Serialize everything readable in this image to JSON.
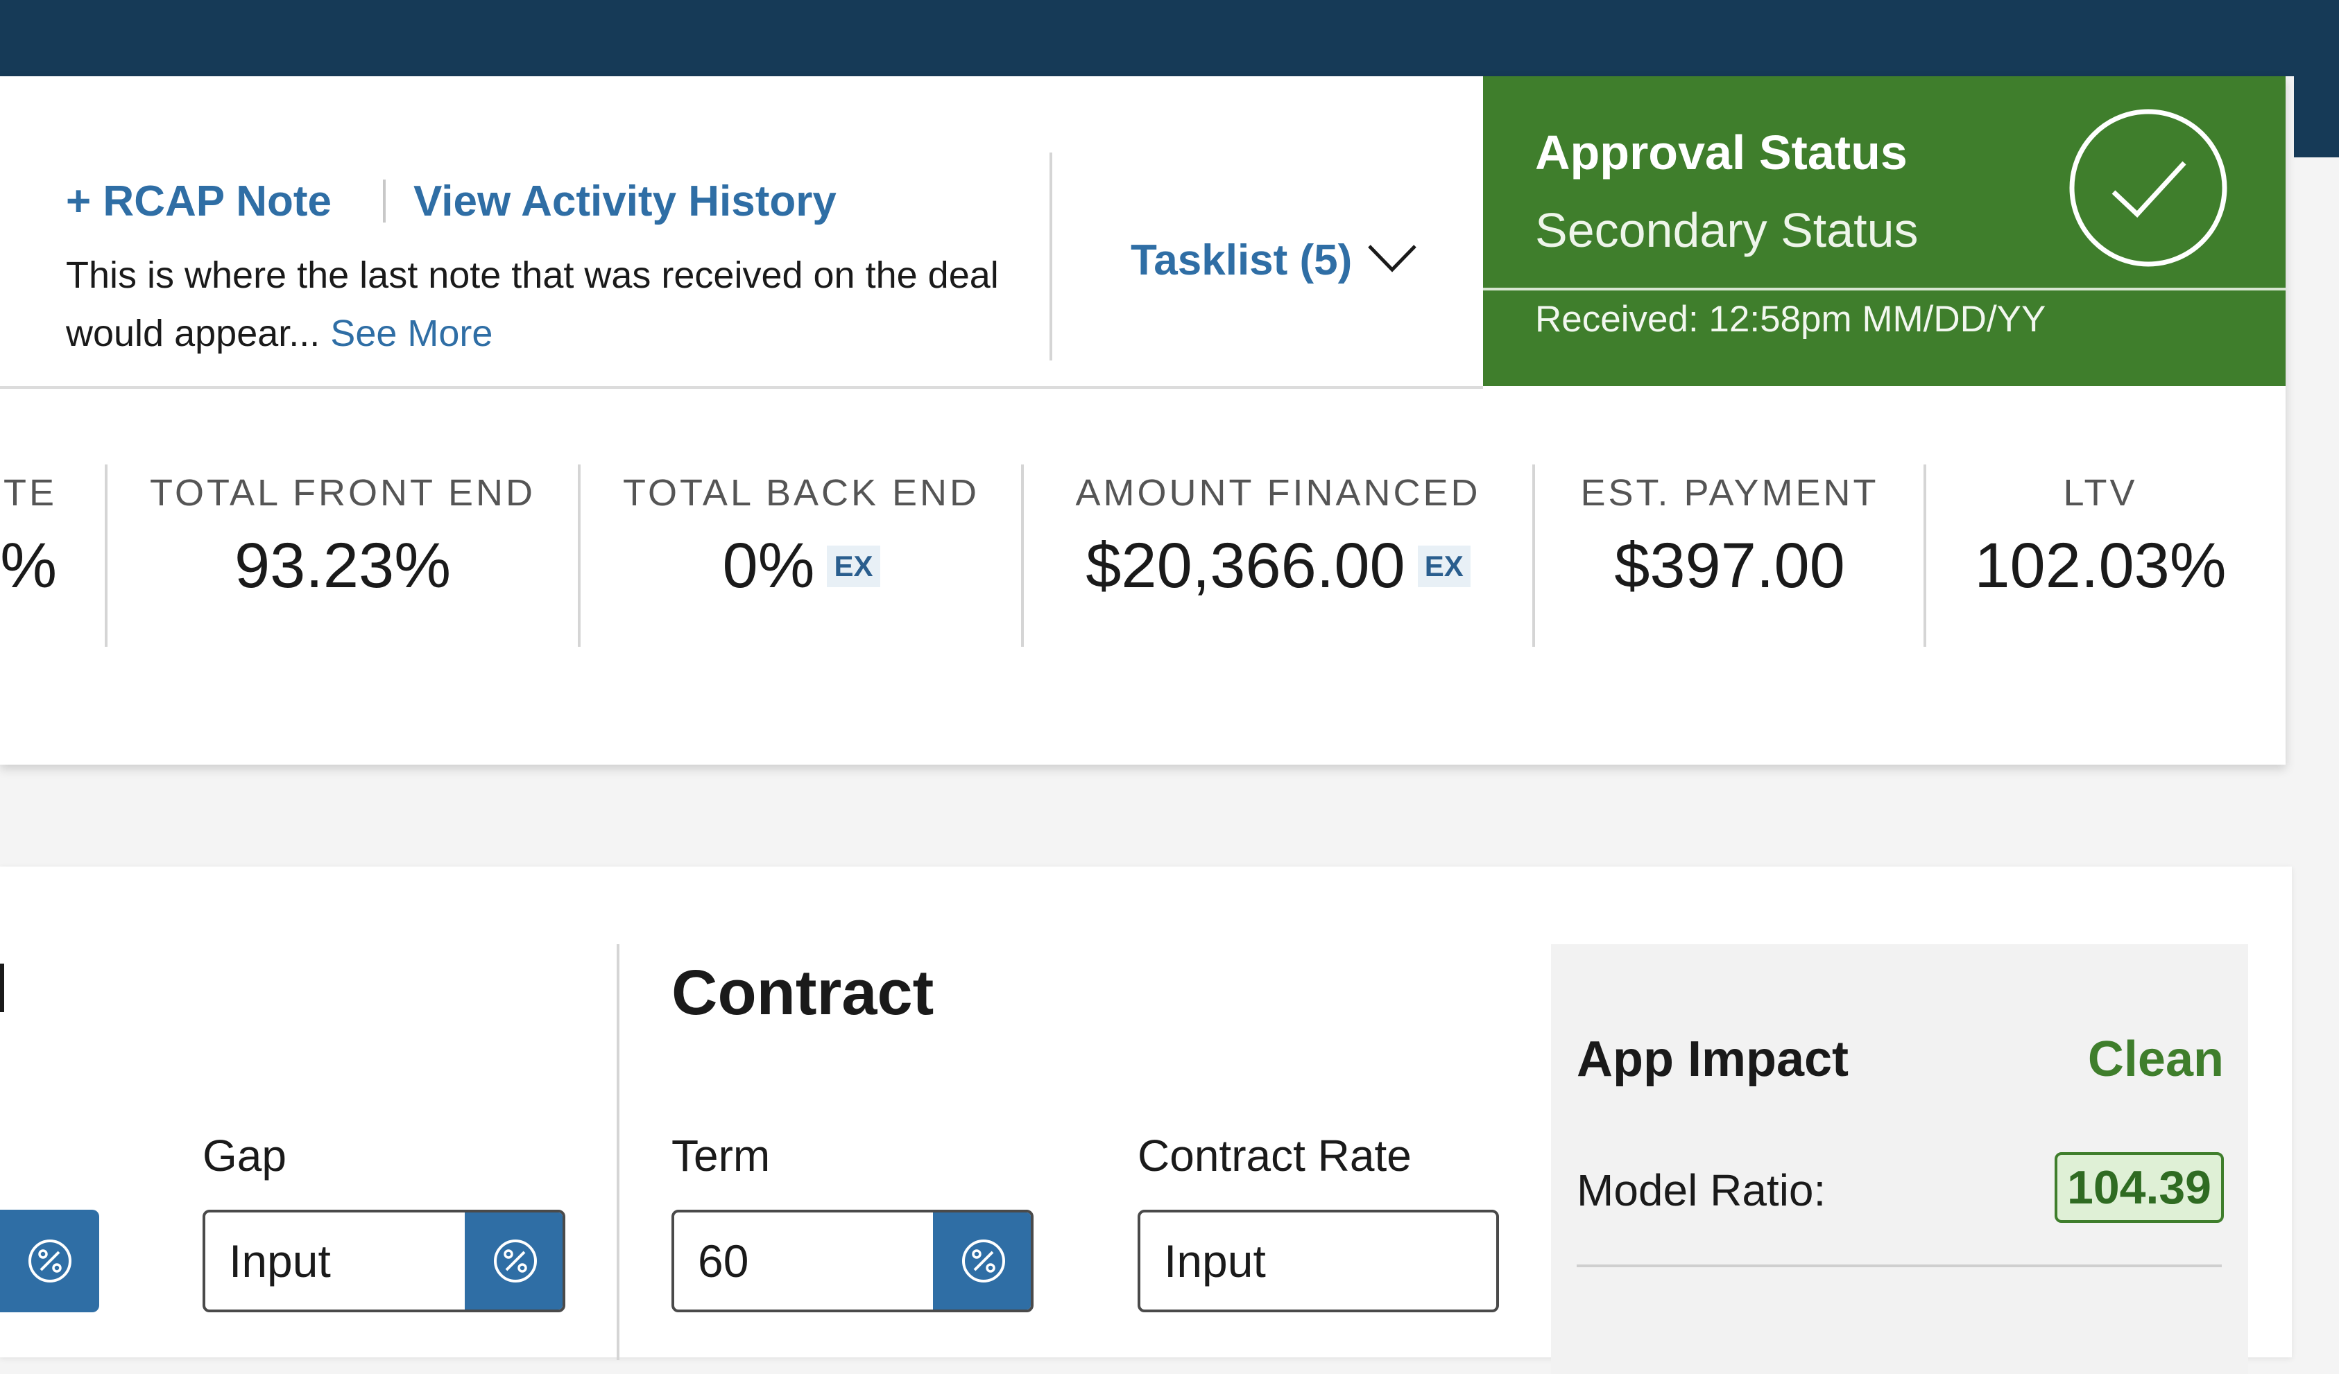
{
  "header": {
    "note_links": {
      "add_note": "+ RCAP Note",
      "activity": "View Activity History"
    },
    "note_text": "This is where the last note that was received on the deal would appear...",
    "see_more": "See More",
    "tasklist": "Tasklist (5)",
    "approval": {
      "title": "Approval Status",
      "subtitle": "Secondary Status",
      "received": "Received: 12:58pm MM/DD/YY",
      "color": "#3f7e2c"
    }
  },
  "metrics": {
    "partial": {
      "label": "TE",
      "value": "%"
    },
    "items": [
      {
        "label": "TOTAL FRONT END",
        "value": "93.23%"
      },
      {
        "label": "TOTAL BACK END",
        "value": "0%",
        "badge": "EX"
      },
      {
        "label": "AMOUNT FINANCED",
        "value": "$20,366.00",
        "badge": "EX"
      },
      {
        "label": "EST. PAYMENT",
        "value": "$397.00"
      },
      {
        "label": "LTV",
        "value": "102.03%"
      }
    ]
  },
  "products": {
    "gap": {
      "label": "Gap",
      "placeholder": "Input"
    }
  },
  "contract": {
    "title": "Contract",
    "term": {
      "label": "Term",
      "value": "60"
    },
    "rate": {
      "label": "Contract Rate",
      "placeholder": "Input"
    }
  },
  "app_impact": {
    "title": "App Impact",
    "status": "Clean",
    "ratio_label": "Model Ratio:",
    "ratio_value": "104.39"
  },
  "colors": {
    "navy": "#163a57",
    "link_blue": "#2f6ea5",
    "green": "#3f7e2c"
  }
}
